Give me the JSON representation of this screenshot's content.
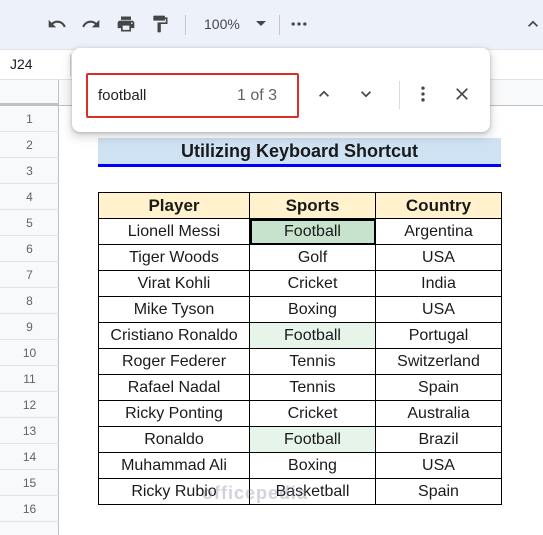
{
  "toolbar": {
    "zoom_label": "100%"
  },
  "namebox": {
    "value": "J24"
  },
  "find": {
    "query": "football",
    "count": "1 of 3"
  },
  "rows": [
    "1",
    "2",
    "3",
    "4",
    "5",
    "6",
    "7",
    "8",
    "9",
    "10",
    "11",
    "12",
    "13",
    "14",
    "15",
    "16"
  ],
  "sheet": {
    "title": "Utilizing Keyboard Shortcut",
    "headers": [
      "Player",
      "Sports",
      "Country"
    ],
    "data": [
      [
        "Lionell Messi",
        "Football",
        "Argentina"
      ],
      [
        "Tiger Woods",
        "Golf",
        "USA"
      ],
      [
        "Virat Kohli",
        "Cricket",
        "India"
      ],
      [
        "Mike Tyson",
        "Boxing",
        "USA"
      ],
      [
        "Cristiano Ronaldo",
        "Football",
        "Portugal"
      ],
      [
        "Roger Federer",
        "Tennis",
        "Switzerland"
      ],
      [
        "Rafael Nadal",
        "Tennis",
        "Spain"
      ],
      [
        "Ricky Ponting",
        "Cricket",
        "Australia"
      ],
      [
        "Ronaldo",
        "Football",
        "Brazil"
      ],
      [
        "Muhammad Ali",
        "Boxing",
        "USA"
      ],
      [
        "Ricky Rubio",
        "Basketball",
        "Spain"
      ]
    ]
  },
  "colors": {
    "title_fill": "#cfe2f3",
    "header_fill": "#fff2cc",
    "match_fill": "#e6f4ea",
    "active_match_fill": "#c7e3cd",
    "find_input_border": "#d93025"
  },
  "watermark": {
    "text": "officepedia"
  }
}
